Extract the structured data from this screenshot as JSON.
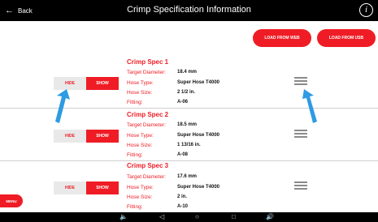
{
  "header": {
    "back_label": "Back",
    "title": "Crimp Specification Information",
    "info_glyph": "i"
  },
  "actions": {
    "load_web": "LOAD FROM WEB",
    "load_usb": "LOAD FROM USB",
    "menu": "MENU"
  },
  "specs": [
    {
      "title": "Crimp Spec 1",
      "hide_label": "HIDE",
      "show_label": "SHOW",
      "target_diameter_label": "Target Diameter:",
      "target_diameter": "18.4 mm",
      "hose_type_label": "Hose Type:",
      "hose_type": "Super Hose T4000",
      "hose_size_label": "Hose Size:",
      "hose_size": "2 1/2 in.",
      "fitting_label": "Fitting:",
      "fitting": "A-06"
    },
    {
      "title": "Crimp Spec 2",
      "hide_label": "HIDE",
      "show_label": "SHOW",
      "target_diameter_label": "Target Diameter:",
      "target_diameter": "18.5 mm",
      "hose_type_label": "Hose Type:",
      "hose_type": "Super Hose T4000",
      "hose_size_label": "Hose Size:",
      "hose_size": "1 13/16 in.",
      "fitting_label": "Fitting:",
      "fitting": "A-08"
    },
    {
      "title": "Crimp Spec 3",
      "hide_label": "HIDE",
      "show_label": "SHOW",
      "target_diameter_label": "Target Diameter:",
      "target_diameter": "17.6 mm",
      "hose_type_label": "Hose Type:",
      "hose_type": "Super Hose T4000",
      "hose_size_label": "Hose Size:",
      "hose_size": "2 in.",
      "fitting_label": "Fitting:",
      "fitting": "A-10"
    }
  ],
  "navbar": {
    "volume_down": "🔈",
    "back": "◁",
    "home": "○",
    "recents": "□",
    "volume_up": "🔊"
  },
  "colors": {
    "accent": "#ef1c25",
    "header": "#000000",
    "annotation_arrow": "#2e9be3"
  },
  "icons": [
    "back-arrow-icon",
    "info-icon",
    "drag-handle-icon",
    "annotation-arrow-icon"
  ]
}
